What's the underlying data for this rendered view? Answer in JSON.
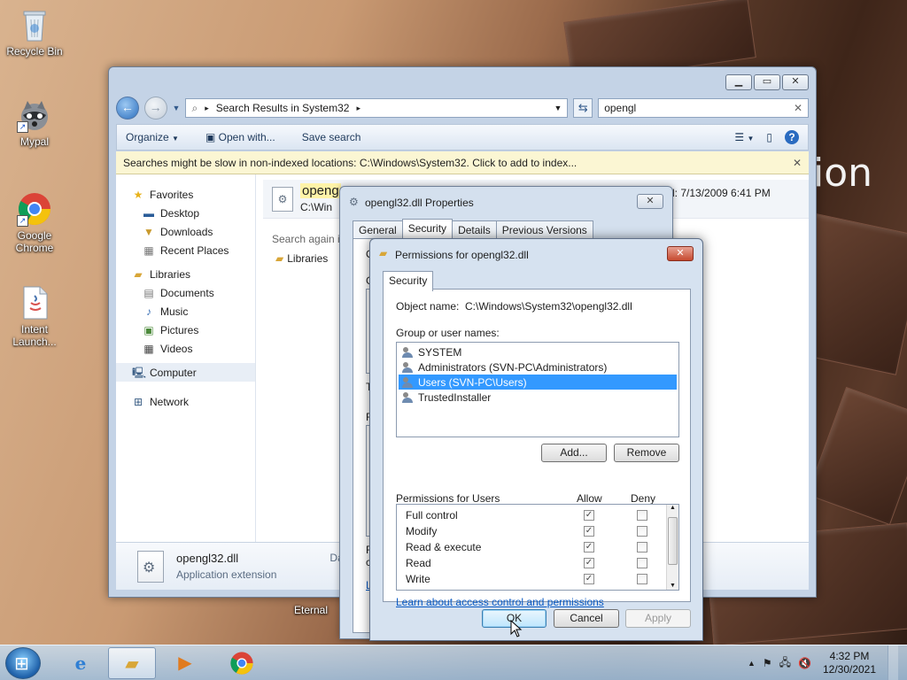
{
  "desktop": {
    "watermark": "ion",
    "icons": [
      {
        "label": "Recycle Bin"
      },
      {
        "label": "Mypal"
      },
      {
        "label": "Google Chrome"
      },
      {
        "label": "Intent Launch..."
      },
      {
        "label": "Eternal"
      }
    ]
  },
  "explorer": {
    "breadcrumb": "Search Results in System32",
    "search_value": "opengl",
    "toolbar": {
      "organize": "Organize",
      "open_with": "Open with...",
      "save_search": "Save search"
    },
    "infobar": "Searches might be slow in non-indexed locations: C:\\Windows\\System32. Click to add to index...",
    "nav": {
      "favorites": "Favorites",
      "favorites_items": [
        "Desktop",
        "Downloads",
        "Recent Places"
      ],
      "libraries": "Libraries",
      "libraries_items": [
        "Documents",
        "Music",
        "Pictures",
        "Videos"
      ],
      "computer": "Computer",
      "network": "Network"
    },
    "result": {
      "name": "openg",
      "path": "C:\\Win",
      "date": "d: 7/13/2009 6:41 PM"
    },
    "search_again": "Search again i",
    "libraries_result": "Libraries",
    "status": {
      "file": "opengl32.dll",
      "type": "Application extension",
      "date_label": "Date modi"
    }
  },
  "properties": {
    "title": "opengl32.dll Properties",
    "tabs": [
      "General",
      "Security",
      "Details",
      "Previous Versions"
    ],
    "fragments": [
      "O",
      "G",
      "T",
      "F",
      "F",
      "c",
      "L"
    ]
  },
  "permissions": {
    "title": "Permissions for opengl32.dll",
    "tab": "Security",
    "object_label": "Object name:",
    "object_value": "C:\\Windows\\System32\\opengl32.dll",
    "group_label": "Group or user names:",
    "users": [
      "SYSTEM",
      "Administrators (SVN-PC\\Administrators)",
      "Users (SVN-PC\\Users)",
      "TrustedInstaller"
    ],
    "selected_user_index": 2,
    "add": "Add...",
    "remove": "Remove",
    "perm_header": "Permissions for Users",
    "allow": "Allow",
    "deny": "Deny",
    "perms": [
      {
        "name": "Full control",
        "allow": true,
        "deny": false
      },
      {
        "name": "Modify",
        "allow": true,
        "deny": false
      },
      {
        "name": "Read & execute",
        "allow": true,
        "deny": false
      },
      {
        "name": "Read",
        "allow": true,
        "deny": false
      },
      {
        "name": "Write",
        "allow": true,
        "deny": false
      }
    ],
    "link": "Learn about access control and permissions",
    "ok": "OK",
    "cancel": "Cancel",
    "apply": "Apply"
  },
  "taskbar": {
    "time": "4:32 PM",
    "date": "12/30/2021"
  }
}
